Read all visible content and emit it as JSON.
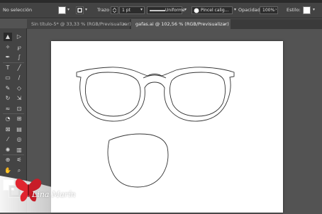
{
  "control_bar": {
    "selection_status": "No selección",
    "stroke_label": "Trazo",
    "stroke_weight": "1 pt",
    "stroke_profile": "Uniforme",
    "brush_name": "Pincel calig...",
    "opacity_label": "Opacidad:",
    "opacity_value": "100%",
    "style_label": "Estilo:"
  },
  "tabs": [
    {
      "label": "Sin título-5* @ 33,33 % (RGB/Previsualizar)",
      "active": false
    },
    {
      "label": "gafas.ai @ 102,56 % (RGB/Previsualizar)",
      "active": true
    }
  ],
  "tab_close_glyph": "×",
  "toolbar": {
    "tools": [
      {
        "icon": "selection-tool-icon",
        "glyph": "▲"
      },
      {
        "icon": "direct-selection-tool-icon",
        "glyph": "▷"
      },
      {
        "icon": "magic-wand-tool-icon",
        "glyph": "✧"
      },
      {
        "icon": "lasso-tool-icon",
        "glyph": "℘"
      },
      {
        "icon": "pen-tool-icon",
        "glyph": "✒"
      },
      {
        "icon": "curvature-tool-icon",
        "glyph": "∫"
      },
      {
        "icon": "type-tool-icon",
        "glyph": "T"
      },
      {
        "icon": "line-segment-tool-icon",
        "glyph": "╱"
      },
      {
        "icon": "rectangle-tool-icon",
        "glyph": "▭"
      },
      {
        "icon": "paintbrush-tool-icon",
        "glyph": "∕"
      },
      {
        "icon": "shaper-tool-icon",
        "glyph": "✎"
      },
      {
        "icon": "eraser-tool-icon",
        "glyph": "◇"
      },
      {
        "icon": "rotate-tool-icon",
        "glyph": "↻"
      },
      {
        "icon": "scale-tool-icon",
        "glyph": "⇲"
      },
      {
        "icon": "warp-tool-icon",
        "glyph": "≈"
      },
      {
        "icon": "free-transform-tool-icon",
        "glyph": "⊡"
      },
      {
        "icon": "shape-builder-tool-icon",
        "glyph": "◔"
      },
      {
        "icon": "perspective-grid-tool-icon",
        "glyph": "⊞"
      },
      {
        "icon": "mesh-tool-icon",
        "glyph": "⊠"
      },
      {
        "icon": "gradient-tool-icon",
        "glyph": "▤"
      },
      {
        "icon": "eyedropper-tool-icon",
        "glyph": "⁄"
      },
      {
        "icon": "blend-tool-icon",
        "glyph": "◎"
      },
      {
        "icon": "symbol-sprayer-tool-icon",
        "glyph": "✺"
      },
      {
        "icon": "column-graph-tool-icon",
        "glyph": "▥"
      },
      {
        "icon": "artboard-tool-icon",
        "glyph": "⊕"
      },
      {
        "icon": "slice-tool-icon",
        "glyph": "⚟"
      },
      {
        "icon": "hand-tool-icon",
        "glyph": "✋"
      },
      {
        "icon": "zoom-tool-icon",
        "glyph": "⌕"
      }
    ],
    "fill_color": "#ffffff",
    "stroke_color": "#000000"
  },
  "colors": {
    "artwork_stroke": "#333333",
    "artboard": "#ffffff",
    "canvas": "#535353"
  },
  "watermark": {
    "text": "Lina Marín",
    "butterfly_color": "#e0242e"
  }
}
